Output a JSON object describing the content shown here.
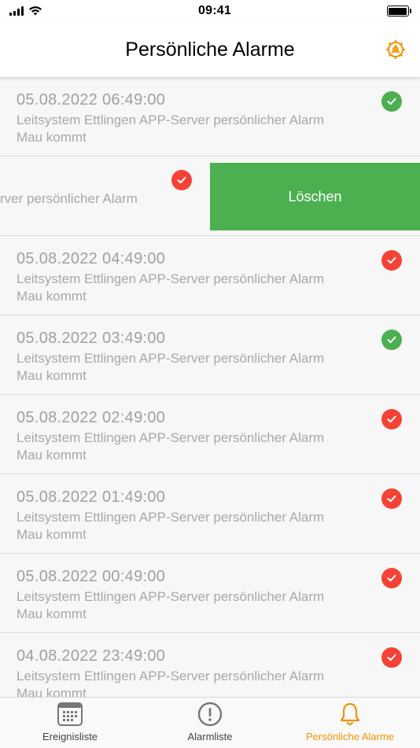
{
  "status_bar": {
    "time": "09:41"
  },
  "header": {
    "title": "Persönliche Alarme",
    "settings_icon": "gear-icon"
  },
  "colors": {
    "accent": "#f39200",
    "ack_green": "#4caf50",
    "alarm_red": "#f44336",
    "delete_green": "#4caf50"
  },
  "alarms": [
    {
      "datetime": "05.08.2022 06:49:00",
      "line1": "Leitsystem Ettlingen APP-Server persönlicher Alarm",
      "line2": "Mau kommt",
      "status": "green"
    },
    {
      "datetime": "",
      "line1": "rver persönlicher Alarm",
      "line2": "",
      "status": "red",
      "swiped": true,
      "delete_label": "Löschen"
    },
    {
      "datetime": "05.08.2022 04:49:00",
      "line1": "Leitsystem Ettlingen APP-Server persönlicher Alarm",
      "line2": "Mau kommt",
      "status": "red"
    },
    {
      "datetime": "05.08.2022 03:49:00",
      "line1": "Leitsystem Ettlingen APP-Server persönlicher Alarm",
      "line2": "Mau kommt",
      "status": "green"
    },
    {
      "datetime": "05.08.2022 02:49:00",
      "line1": "Leitsystem Ettlingen APP-Server persönlicher Alarm",
      "line2": "Mau kommt",
      "status": "red"
    },
    {
      "datetime": "05.08.2022 01:49:00",
      "line1": "Leitsystem Ettlingen APP-Server persönlicher Alarm",
      "line2": "Mau kommt",
      "status": "red"
    },
    {
      "datetime": "05.08.2022 00:49:00",
      "line1": "Leitsystem Ettlingen APP-Server persönlicher Alarm",
      "line2": "Mau kommt",
      "status": "red"
    },
    {
      "datetime": "04.08.2022 23:49:00",
      "line1": "Leitsystem Ettlingen APP-Server persönlicher Alarm",
      "line2": "Mau kommt",
      "status": "red"
    }
  ],
  "tabs": [
    {
      "label": "Ereignisliste",
      "icon": "calendar-icon",
      "active": false
    },
    {
      "label": "Alarmliste",
      "icon": "exclamation-circle-icon",
      "active": false
    },
    {
      "label": "Persönliche Alarme",
      "icon": "bell-icon",
      "active": true
    }
  ]
}
